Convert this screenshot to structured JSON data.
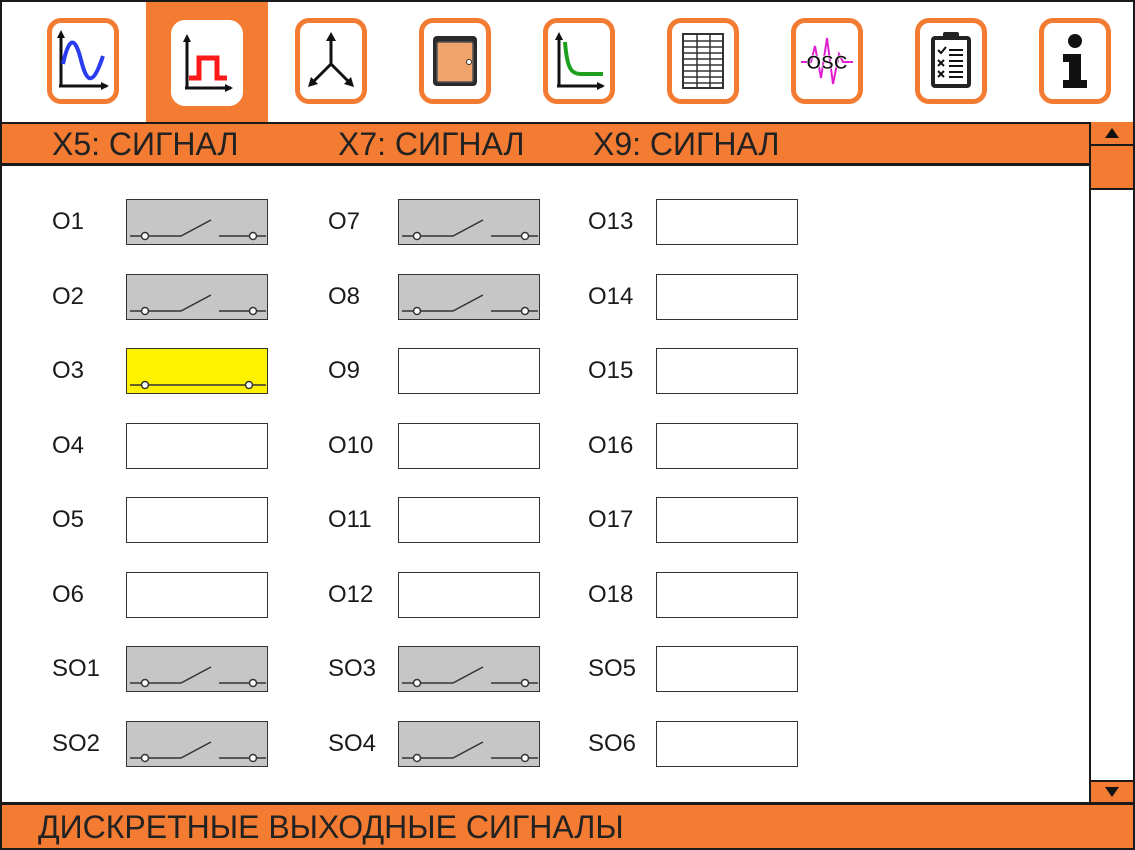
{
  "colors": {
    "accent": "#f37b32",
    "contact_closed": "#fff200",
    "contact_open": "#c6c6c6"
  },
  "toolbar": {
    "tabs": [
      {
        "icon": "sine-wave-icon",
        "active": false
      },
      {
        "icon": "pulse-signal-icon",
        "active": true
      },
      {
        "icon": "three-axis-vector-icon",
        "active": false
      },
      {
        "icon": "device-cabinet-icon",
        "active": false
      },
      {
        "icon": "decay-curve-icon",
        "active": false
      },
      {
        "icon": "table-grid-icon",
        "active": false
      },
      {
        "icon": "oscilloscope-icon",
        "active": false,
        "text": "OSC"
      },
      {
        "icon": "checklist-icon",
        "active": false
      },
      {
        "icon": "info-icon",
        "active": false
      }
    ]
  },
  "header": {
    "col1": "X5: СИГНАЛ",
    "col2": "X7: СИГНАЛ",
    "col3": "X9: СИГНАЛ"
  },
  "outputs": {
    "col1": [
      {
        "label": "O1",
        "state": "open"
      },
      {
        "label": "O2",
        "state": "open"
      },
      {
        "label": "O3",
        "state": "closed"
      },
      {
        "label": "O4",
        "state": "none"
      },
      {
        "label": "O5",
        "state": "none"
      },
      {
        "label": "O6",
        "state": "none"
      },
      {
        "label": "SO1",
        "state": "open"
      },
      {
        "label": "SO2",
        "state": "open"
      }
    ],
    "col2": [
      {
        "label": "O7",
        "state": "open"
      },
      {
        "label": "O8",
        "state": "open"
      },
      {
        "label": "O9",
        "state": "none"
      },
      {
        "label": "O10",
        "state": "none"
      },
      {
        "label": "O11",
        "state": "none"
      },
      {
        "label": "O12",
        "state": "none"
      },
      {
        "label": "SO3",
        "state": "open"
      },
      {
        "label": "SO4",
        "state": "open"
      }
    ],
    "col3": [
      {
        "label": "O13",
        "state": "none"
      },
      {
        "label": "O14",
        "state": "none"
      },
      {
        "label": "O15",
        "state": "none"
      },
      {
        "label": "O16",
        "state": "none"
      },
      {
        "label": "O17",
        "state": "none"
      },
      {
        "label": "O18",
        "state": "none"
      },
      {
        "label": "SO5",
        "state": "none"
      },
      {
        "label": "SO6",
        "state": "none"
      }
    ]
  },
  "footer": {
    "title": "ДИСКРЕТНЫЕ ВЫХОДНЫЕ СИГНАЛЫ"
  }
}
